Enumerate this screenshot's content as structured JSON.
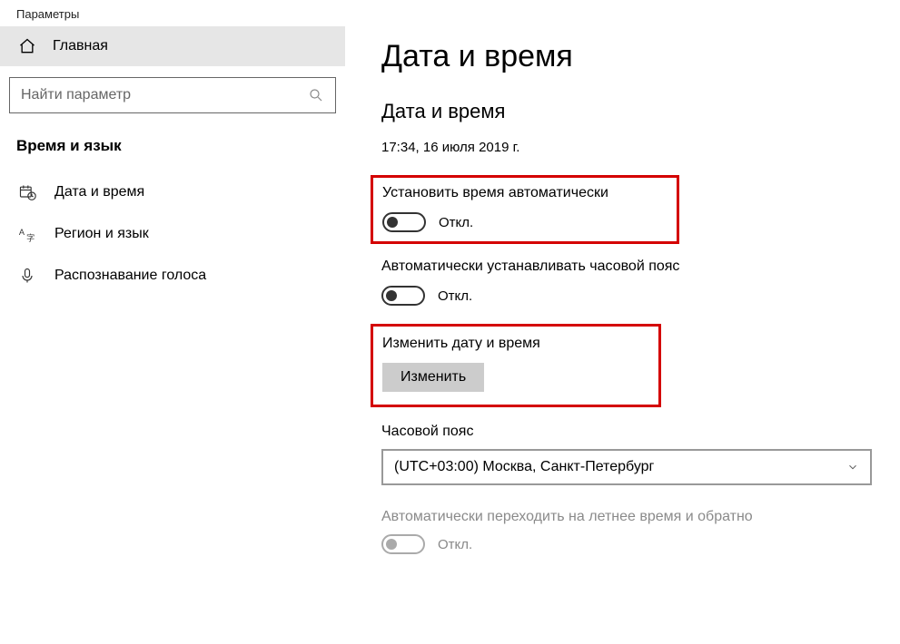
{
  "window": {
    "title": "Параметры"
  },
  "sidebar": {
    "home_label": "Главная",
    "search_placeholder": "Найти параметр",
    "section_header": "Время и язык",
    "items": [
      {
        "label": "Дата и время"
      },
      {
        "label": "Регион и язык"
      },
      {
        "label": "Распознавание голоса"
      }
    ]
  },
  "main": {
    "page_title": "Дата и время",
    "sub_title": "Дата и время",
    "current_datetime": "17:34, 16 июля 2019 г.",
    "auto_time": {
      "label": "Установить время автоматически",
      "state_text": "Откл."
    },
    "auto_tz": {
      "label": "Автоматически устанавливать часовой пояс",
      "state_text": "Откл."
    },
    "change_dt": {
      "label": "Изменить дату и время",
      "button": "Изменить"
    },
    "timezone": {
      "label": "Часовой пояс",
      "selected": "(UTC+03:00) Москва, Санкт-Петербург"
    },
    "dst": {
      "label": "Автоматически переходить на летнее время и обратно",
      "state_text": "Откл."
    }
  }
}
